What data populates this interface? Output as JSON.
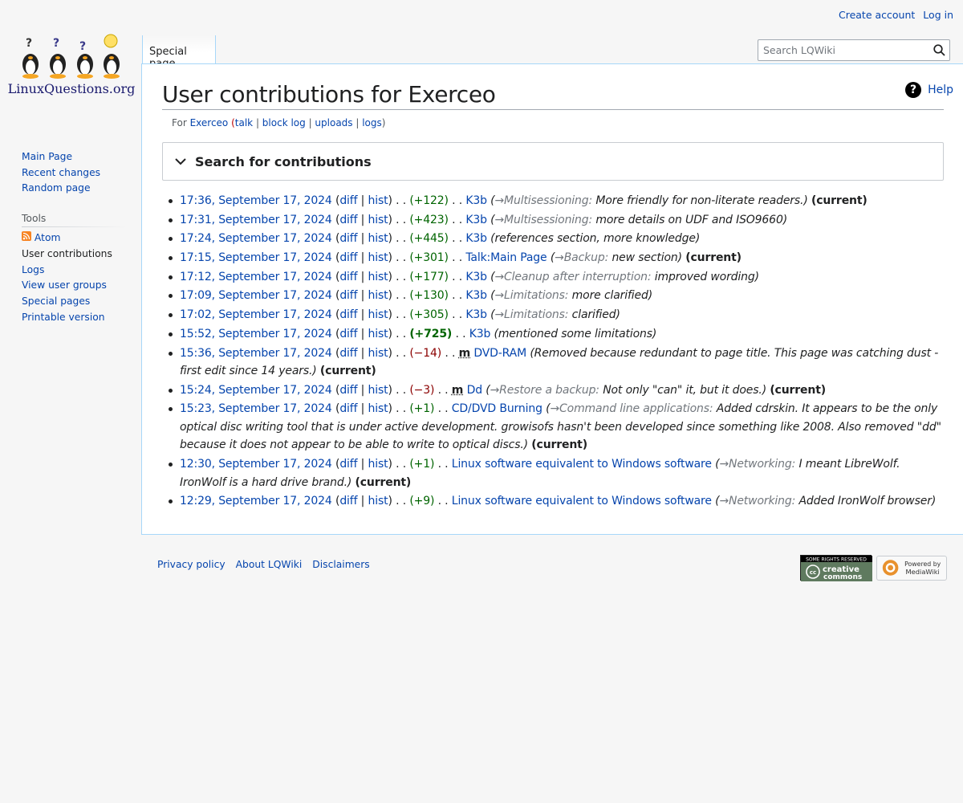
{
  "personal": {
    "create_account": "Create account",
    "login": "Log in"
  },
  "logo": {
    "text": "LinuxQuestions.org"
  },
  "tabs": {
    "special_page": "Special page"
  },
  "search": {
    "placeholder": "Search LQWiki"
  },
  "page": {
    "title": "User contributions for Exerceo",
    "help": "Help",
    "subtitle": {
      "prefix": "For ",
      "user": "Exerceo",
      "open": " (",
      "talk": "talk",
      "sep1": " | ",
      "block_log": "block log",
      "sep2": " | ",
      "uploads": "uploads",
      "sep3": " | ",
      "logs": "logs",
      "close": ")"
    },
    "search_contributions": "Search for contributions"
  },
  "labels": {
    "diff": "diff",
    "hist": "hist",
    "current": "(current)",
    "minor": "m",
    "dots": " . . "
  },
  "contributions": [
    {
      "time": "17:36, September 17, 2024",
      "size": "(+122)",
      "page": "K3b",
      "section": "→Multisessioning:",
      "comment": " More friendly for non-literate readers.",
      "current": true
    },
    {
      "time": "17:31, September 17, 2024",
      "size": "(+423)",
      "page": "K3b",
      "section": "→Multisessioning:",
      "comment": " more details on UDF and ISO9660",
      "current": false
    },
    {
      "time": "17:24, September 17, 2024",
      "size": "(+445)",
      "page": "K3b",
      "section": "",
      "comment": "references section, more knowledge",
      "current": false
    },
    {
      "time": "17:15, September 17, 2024",
      "size": "(+301)",
      "page": "Talk:Main Page",
      "section": "→Backup:",
      "comment": " new section",
      "current": true
    },
    {
      "time": "17:12, September 17, 2024",
      "size": "(+177)",
      "page": "K3b",
      "section": "→Cleanup after interruption:",
      "comment": " improved wording",
      "current": false
    },
    {
      "time": "17:09, September 17, 2024",
      "size": "(+130)",
      "page": "K3b",
      "section": "→Limitations:",
      "comment": " more clarified",
      "current": false
    },
    {
      "time": "17:02, September 17, 2024",
      "size": "(+305)",
      "page": "K3b",
      "section": "→Limitations:",
      "comment": " clarified",
      "current": false
    },
    {
      "time": "15:52, September 17, 2024",
      "size": "(+725)",
      "page": "K3b",
      "section": "",
      "comment": "mentioned some limitations",
      "current": false
    },
    {
      "time": "15:36, September 17, 2024",
      "size": "(−14)",
      "page": "DVD-RAM",
      "minor": true,
      "section": "",
      "comment": "Removed because redundant to page title. This page was catching dust - first edit since 14 years.",
      "current": true
    },
    {
      "time": "15:24, September 17, 2024",
      "size": "(−3)",
      "page": "Dd",
      "minor": true,
      "section": "→Restore a backup:",
      "comment": " Not only \"can\" it, but it does.",
      "current": true
    },
    {
      "time": "15:23, September 17, 2024",
      "size": "(+1)",
      "page": "CD/DVD Burning",
      "section": "→Command line applications:",
      "comment": " Added cdrskin. It appears to be the only optical disc writing tool that is under active development. growisofs hasn't been developed since something like 2008. Also removed \"dd\" because it does not appear to be able to write to optical discs.",
      "current": true
    },
    {
      "time": "12:30, September 17, 2024",
      "size": "(+1)",
      "page": "Linux software equivalent to Windows software",
      "section": "→Networking:",
      "comment": " I meant LibreWolf. IronWolf is a hard drive brand.",
      "current": true
    },
    {
      "time": "12:29, September 17, 2024",
      "size": "(+9)",
      "page": "Linux software equivalent to Windows software",
      "section": "→Networking:",
      "comment": " Added IronWolf browser",
      "current": false
    }
  ],
  "sidebar": {
    "navigation": [
      "Main Page",
      "Recent changes",
      "Random page"
    ],
    "tools_heading": "Tools",
    "tools": [
      "Atom",
      "User contributions",
      "Logs",
      "View user groups",
      "Special pages",
      "Printable version"
    ]
  },
  "footer": {
    "links": [
      "Privacy policy",
      "About LQWiki",
      "Disclaimers"
    ],
    "cc_top": "SOME RIGHTS RESERVED",
    "cc_main": "creative",
    "cc_sub": "commons",
    "mw_line1": "Powered by",
    "mw_line2": "MediaWiki"
  },
  "colors": {
    "link": "#0645ad",
    "redlink": "#ba0000",
    "positive": "#006400",
    "negative": "#8b0000",
    "border": "#a7d7f9"
  }
}
